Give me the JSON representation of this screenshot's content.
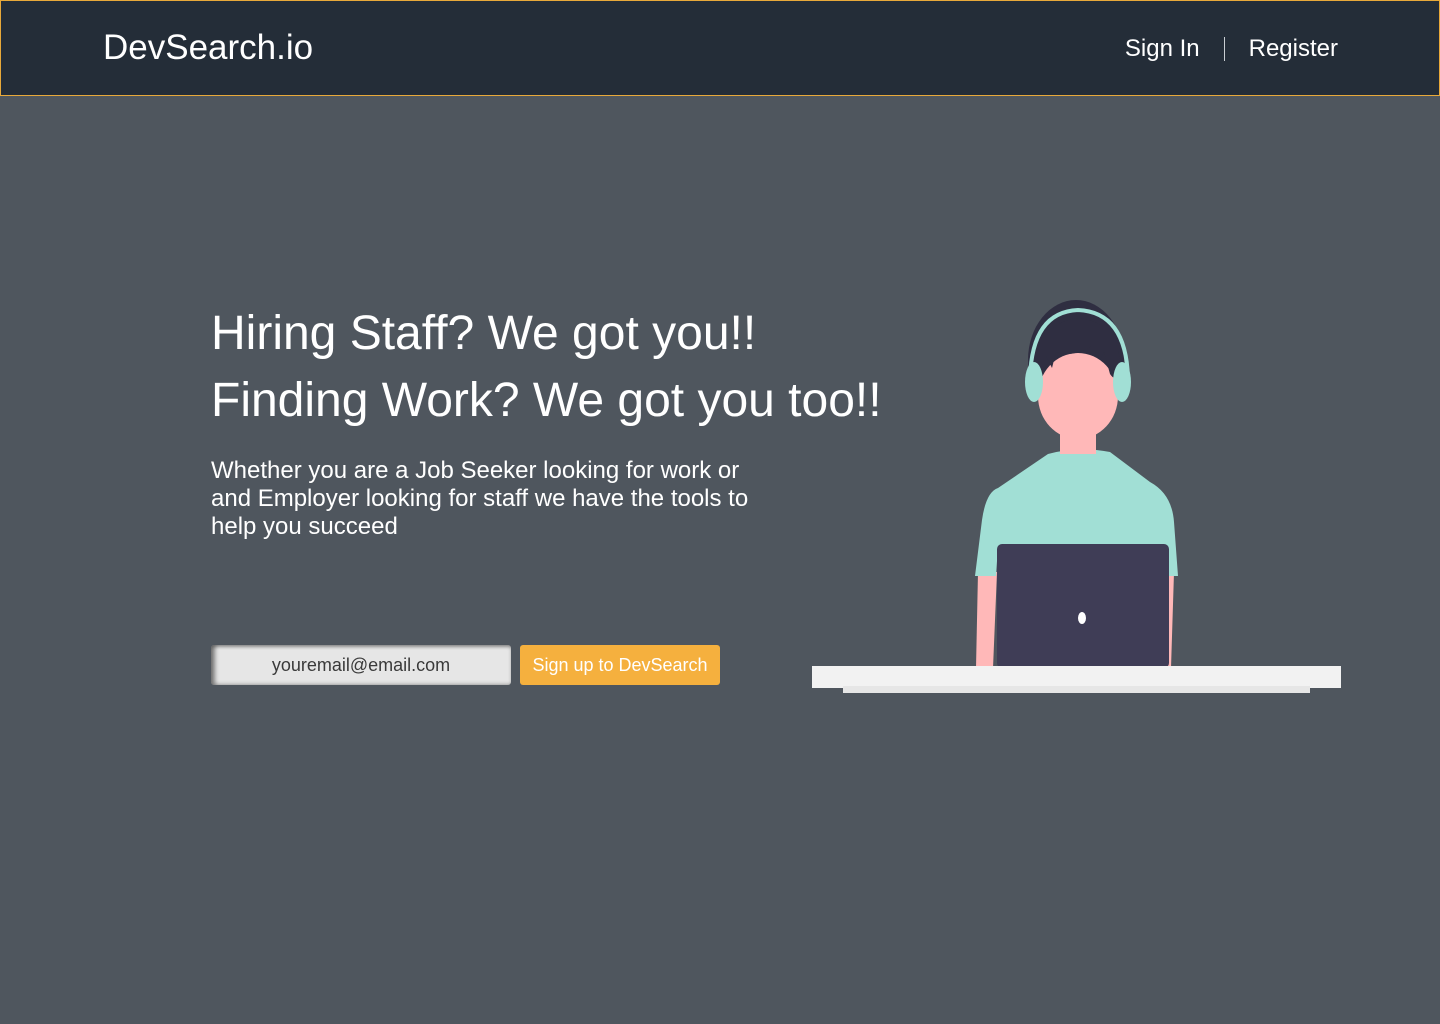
{
  "header": {
    "logo": "DevSearch.io",
    "nav": {
      "sign_in": "Sign In",
      "register": "Register"
    }
  },
  "hero": {
    "title_line1": "Hiring Staff? We got you!!",
    "title_line2": "Finding Work? We got you too!!",
    "description": "Whether you are a Job Seeker looking for work or and Employer looking for staff we have the tools to help you succeed"
  },
  "signup": {
    "email_placeholder": "youremail@email.com",
    "button_label": "Sign up to DevSearch"
  },
  "colors": {
    "header_bg": "#242d38",
    "header_border": "#e8a93a",
    "page_bg": "#4f565e",
    "accent": "#f5b03e",
    "shirt": "#a1dfd5",
    "skin": "#ffb8b8",
    "hair": "#2f2e41",
    "laptop": "#3f3d56",
    "desk": "#f2f2f2"
  },
  "icons": {
    "illustration": "person-with-headphones-at-laptop-illustration"
  }
}
